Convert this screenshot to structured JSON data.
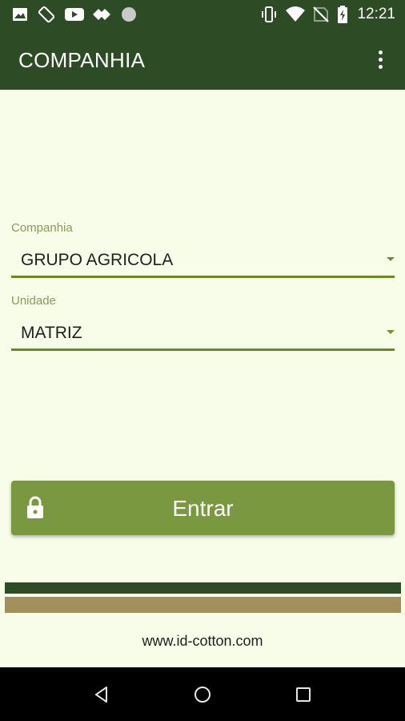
{
  "status_bar": {
    "time": "12:21",
    "icons": [
      "image-icon",
      "screen-rotation-icon",
      "youtube-icon",
      "wireless-display-icon",
      "circle-dot-icon",
      "vibrate-icon",
      "wifi-icon",
      "no-sim-icon",
      "battery-charging-icon"
    ]
  },
  "app_bar": {
    "title": "COMPANHIA",
    "menu_icon": "more-vert-icon"
  },
  "form": {
    "company_label": "Companhia",
    "company_value": "GRUPO AGRICOLA",
    "unit_label": "Unidade",
    "unit_value": "MATRIZ"
  },
  "enter_button": {
    "label": "Entrar",
    "icon": "lock-icon"
  },
  "footer": {
    "url": "www.id-cotton.com"
  },
  "nav_bar": {
    "icons": [
      "back-icon",
      "home-icon",
      "recents-icon"
    ]
  },
  "colors": {
    "primary_dark": "#2d4b25",
    "background": "#f7fde9",
    "button": "#7a9840",
    "accent_line": "#6b8a1f",
    "tan_stripe": "#a38f5c"
  }
}
